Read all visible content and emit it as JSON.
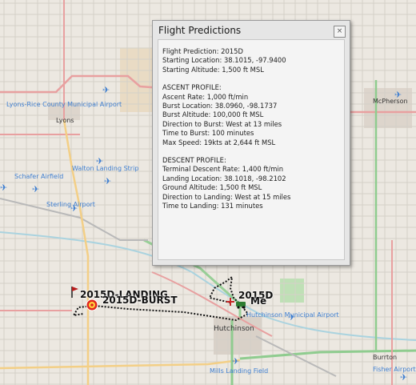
{
  "map": {
    "labels": {
      "lyrons_airport": "Lyons-Rice County Municipal Airport",
      "lyons": "Lyons",
      "mcpherson": "McPherson",
      "walton": "Walton Landing Strip",
      "schafer": "Schafer Airfield",
      "sterling": "Sterling Airport",
      "hutchinson_airport": "Hutchinson Municipal Airport",
      "hutchinson": "Hutchinson",
      "burrton": "Burrton",
      "mills": "Mills Landing Field",
      "fisher": "Fisher Airport"
    },
    "markers": {
      "landing": "2015D-LANDING",
      "burst": "2015D-BURST",
      "launch": "2015D",
      "me": "Me"
    }
  },
  "panel": {
    "title": "Flight Predictions",
    "close_glyph": "×",
    "prediction": "Flight Prediction: 2015D",
    "start_location": "Starting Location: 38.1015, -97.9400",
    "start_altitude": "Starting Altitude: 1,500 ft MSL",
    "ascent_header": "ASCENT PROFILE:",
    "ascent_rate": "Ascent Rate: 1,000 ft/min",
    "burst_location": "Burst Location: 38.0960, -98.1737",
    "burst_altitude": "Burst Altitude: 100,000 ft MSL",
    "direction_burst": "Direction to Burst: West at 13 miles",
    "time_burst": "Time to Burst: 100 minutes",
    "max_speed": "Max Speed: 19kts at 2,644 ft MSL",
    "descent_header": "DESCENT PROFILE:",
    "descent_rate": "Terminal Descent Rate: 1,400 ft/min",
    "landing_location": "Landing Location: 38.1018, -98.2102",
    "ground_altitude": "Ground Altitude: 1,500 ft MSL",
    "direction_landing": "Direction to Landing: West at 15 miles",
    "time_landing": "Time to Landing: 131 minutes"
  },
  "colors": {
    "road_primary": "#e8a0a0",
    "road_secondary": "#f3cf86",
    "highway_green": "#8fcc8f",
    "airport_blue": "#3f7fd1",
    "flight_path": "#111111",
    "burst_marker": "#e0261b"
  },
  "icons": {
    "close": "close-icon",
    "burst": "target-icon",
    "landing": "flag-icon",
    "launch": "crosshair-icon",
    "me": "vehicle-icon",
    "airport": "airplane-icon"
  }
}
